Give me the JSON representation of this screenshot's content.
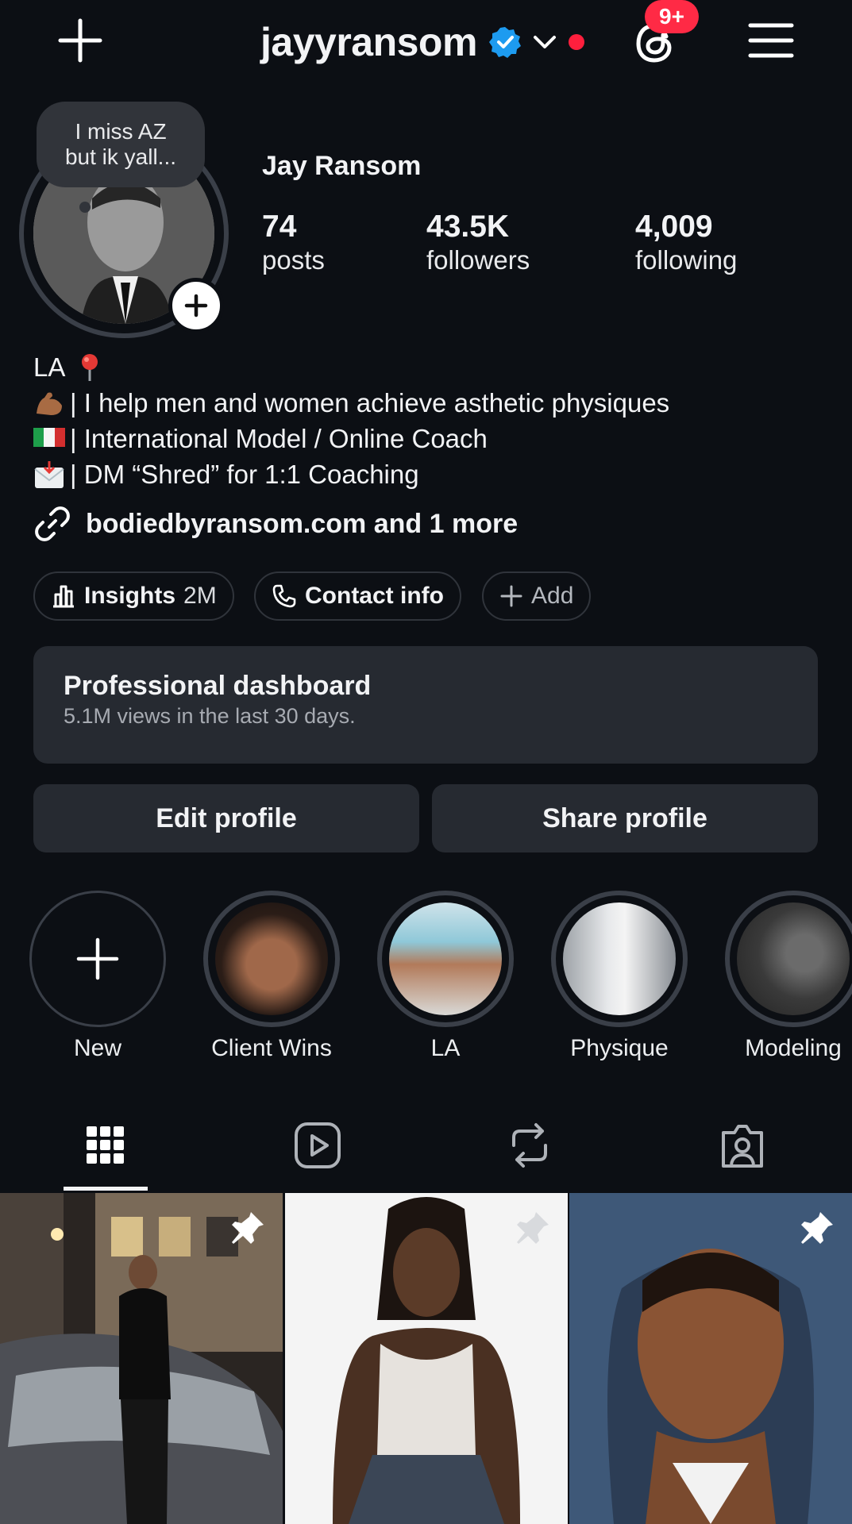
{
  "header": {
    "username": "jayyransom",
    "notification_badge": "9+",
    "icons": {
      "create": "plus-icon",
      "verified": "verified-badge-icon",
      "switch": "chevron-down-icon",
      "threads": "threads-icon",
      "menu": "hamburger-menu-icon"
    },
    "colors": {
      "verified": "#1d9bf0",
      "badge": "#ff2a45"
    }
  },
  "profile": {
    "note": {
      "line1": "I miss AZ",
      "line2": "but ik yall..."
    },
    "display_name": "Jay Ransom",
    "stats": [
      {
        "value": "74",
        "label": "posts"
      },
      {
        "value": "43.5K",
        "label": "followers"
      },
      {
        "value": "4,009",
        "label": "following"
      }
    ],
    "bio": {
      "line1": "LA",
      "line2": "| I help men and women achieve asthetic physiques",
      "line3": "| International Model / Online Coach",
      "line4": "| DM “Shred” for 1:1 Coaching"
    },
    "link": "bodiedbyransom.com and 1 more"
  },
  "chips": {
    "insights_label": "Insights",
    "insights_value": "2M",
    "contact_label": "Contact info",
    "add_label": "Add"
  },
  "dashboard": {
    "title": "Professional dashboard",
    "subtitle": "5.1M views in the last 30 days."
  },
  "buttons": {
    "edit": "Edit profile",
    "share": "Share profile"
  },
  "highlights": [
    {
      "label": "New"
    },
    {
      "label": "Client Wins"
    },
    {
      "label": "LA"
    },
    {
      "label": "Physique"
    },
    {
      "label": "Modeling"
    }
  ],
  "tabs": [
    "grid-icon",
    "reels-icon",
    "reposts-icon",
    "tagged-icon"
  ]
}
